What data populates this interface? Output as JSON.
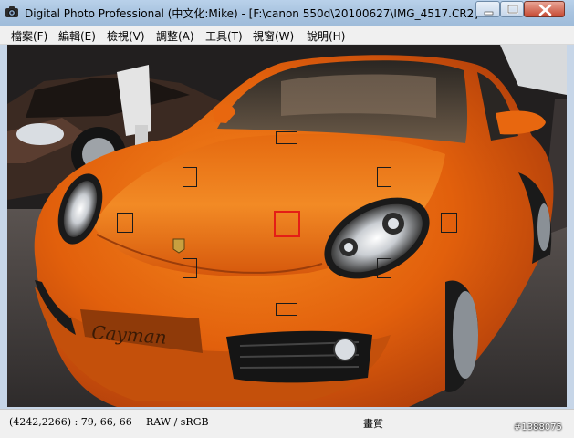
{
  "window": {
    "title": "Digital Photo Professional (中文化:Mike) - [F:\\canon 550d\\20100627\\IMG_4517.CR2]"
  },
  "menu": {
    "items": [
      {
        "label": "檔案(F)"
      },
      {
        "label": "編輯(E)"
      },
      {
        "label": "檢視(V)"
      },
      {
        "label": "調整(A)"
      },
      {
        "label": "工具(T)"
      },
      {
        "label": "視窗(W)"
      },
      {
        "label": "說明(H)"
      }
    ]
  },
  "image": {
    "subject": "orange Porsche Cayman at car show",
    "plate_text": "Cayman",
    "af_points_count": 9,
    "active_af_point": "center"
  },
  "status": {
    "coords_rgb": "(4242,2266) : 79, 66, 66",
    "format": "RAW / sRGB",
    "quality_label": "畫質"
  },
  "watermark": "#1388075",
  "colors": {
    "titlebar": "#a9c4e0",
    "car_orange": "#e8650f",
    "af_active": "#e41e16"
  }
}
